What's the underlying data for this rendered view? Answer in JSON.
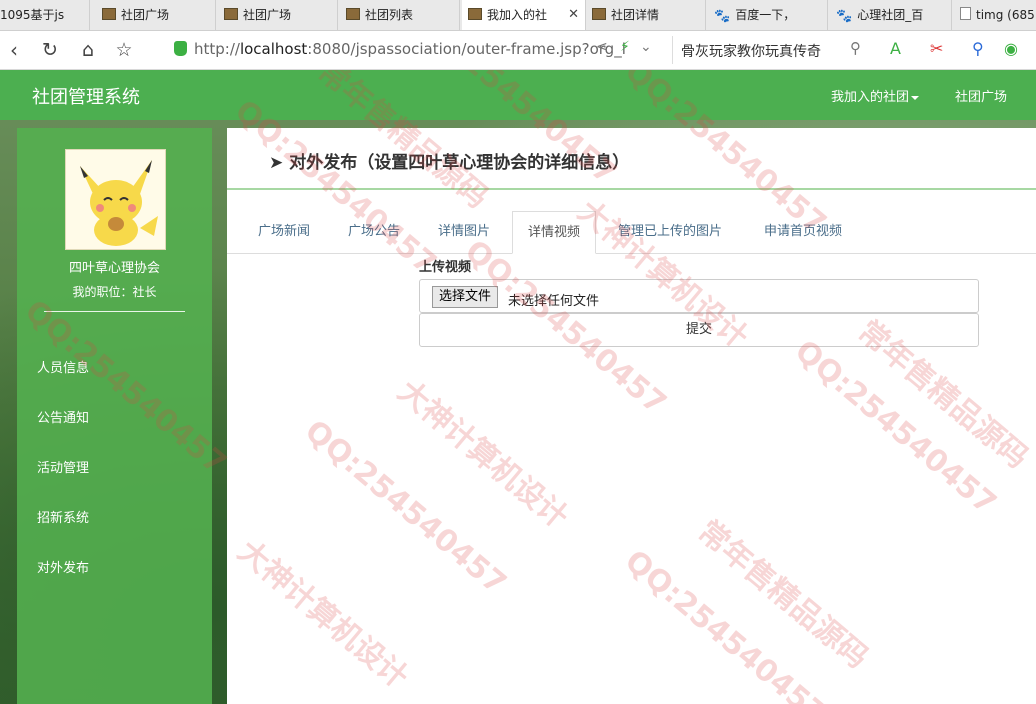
{
  "browser": {
    "tabs": [
      {
        "label": "1095基于js"
      },
      {
        "label": "社团广场"
      },
      {
        "label": "社团广场"
      },
      {
        "label": "社团列表"
      },
      {
        "label": "我加入的社",
        "active": true
      },
      {
        "label": "社团详情"
      },
      {
        "label": "百度一下，"
      },
      {
        "label": "心理社团_百"
      },
      {
        "label": "timg (685"
      }
    ],
    "url_host": "localhost",
    "url_rest": ":8080/jspassociation/outer-frame.jsp?org_i",
    "url_prefix": "http://",
    "search_text": "骨灰玩家教你玩真传奇"
  },
  "app": {
    "brand": "社团管理系统",
    "nav_joined": "我加入的社团",
    "nav_square": "社团广场"
  },
  "sidebar": {
    "org_name": "四叶草心理协会",
    "role": "我的职位：社长",
    "items": [
      {
        "label": "人员信息"
      },
      {
        "label": "公告通知"
      },
      {
        "label": "活动管理"
      },
      {
        "label": "招新系统"
      },
      {
        "label": "对外发布"
      }
    ]
  },
  "main": {
    "title": "对外发布（设置四叶草心理协会的详细信息）",
    "tabs": [
      {
        "label": "广场新闻"
      },
      {
        "label": "广场公告"
      },
      {
        "label": "详情图片"
      },
      {
        "label": "详情视频",
        "active": true
      },
      {
        "label": "管理已上传的图片"
      },
      {
        "label": "申请首页视频"
      }
    ],
    "upload_label": "上传视频",
    "file_button": "选择文件",
    "file_status": "未选择任何文件",
    "submit": "提交"
  },
  "watermarks": {
    "qq": "QQ:254540457",
    "design": "大神计算机设计",
    "source": "常年售精品源码"
  },
  "colors": {
    "accent": "#4caf50",
    "sidebar": "#54b050",
    "tab_link": "#4a6e8a"
  }
}
